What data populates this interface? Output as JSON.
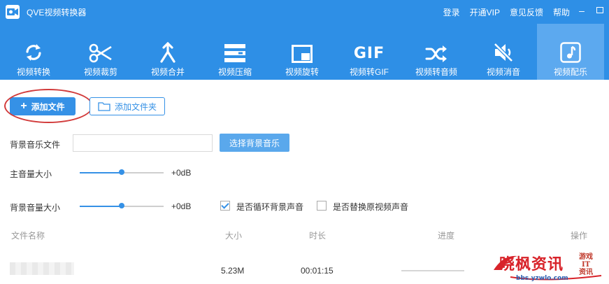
{
  "app": {
    "title": "QVE视频转换器"
  },
  "title_links": [
    "登录",
    "开通VIP",
    "意见反馈",
    "帮助"
  ],
  "window_controls": {
    "minimize": "–"
  },
  "toolbar": [
    {
      "label": "视频转换",
      "icon": "sync-icon"
    },
    {
      "label": "视频裁剪",
      "icon": "scissors-icon"
    },
    {
      "label": "视频合并",
      "icon": "merge-icon"
    },
    {
      "label": "视频压缩",
      "icon": "compress-icon"
    },
    {
      "label": "视频旋转",
      "icon": "rotate-icon"
    },
    {
      "label": "视频转GIF",
      "icon": "gif-icon",
      "icon_text": "GIF"
    },
    {
      "label": "视频转音频",
      "icon": "shuffle-icon"
    },
    {
      "label": "视频消音",
      "icon": "mute-icon"
    },
    {
      "label": "视频配乐",
      "icon": "music-icon",
      "active": true
    }
  ],
  "actions": {
    "add_file": "添加文件",
    "add_folder": "添加文件夹",
    "add_symbol": "+"
  },
  "bg_music": {
    "label": "背景音乐文件",
    "value": "",
    "choose_button": "选择背景音乐"
  },
  "main_volume": {
    "label": "主音量大小",
    "value_text": "+0dB",
    "level": 0.5
  },
  "bg_volume": {
    "label": "背景音量大小",
    "value_text": "+0dB",
    "level": 0.5
  },
  "options": {
    "loop_bg": {
      "label": "是否循环背景声音",
      "checked": true
    },
    "replace_original": {
      "label": "是否替换原视频声音",
      "checked": false
    }
  },
  "table": {
    "headers": [
      "文件名称",
      "大小",
      "时长",
      "进度",
      "操作"
    ],
    "rows": [
      {
        "name": "",
        "size": "5.23M",
        "duration": "00:01:15"
      }
    ]
  },
  "watermark": {
    "main": "晓枫资讯",
    "side": [
      "游戏",
      "IT",
      "资讯"
    ],
    "url": "bbs.yzwlo.com"
  },
  "colors": {
    "primary": "#2e8fe6",
    "active_tab": "#5ca9ef",
    "accent": "#3591e6",
    "highlight_ring": "#d23b3b"
  }
}
